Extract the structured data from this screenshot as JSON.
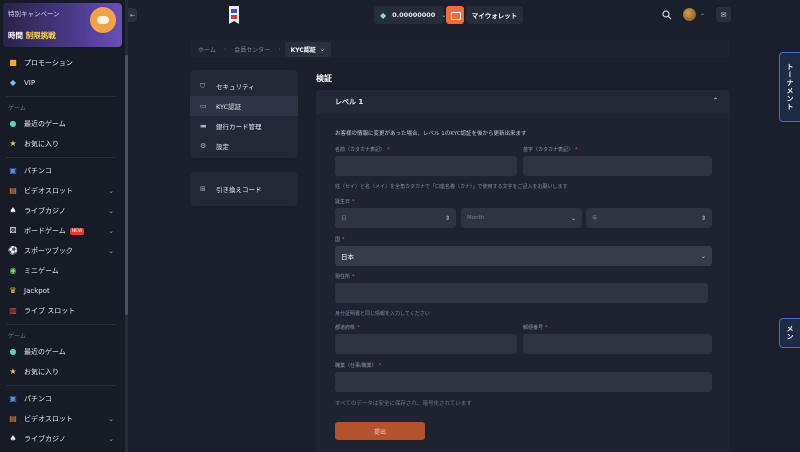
{
  "sidebar": {
    "promo": {
      "small_text": "特別キャンペーン",
      "big_prefix": "時間",
      "big_highlight": "制限挑戦"
    },
    "items_top": [
      {
        "label": "プロモーション",
        "icon": "gift-icon"
      },
      {
        "label": "VIP",
        "icon": "diamond-icon"
      }
    ],
    "section_game": "ゲーム",
    "items_game": [
      {
        "label": "最近のゲーム",
        "icon": "history-icon"
      },
      {
        "label": "お気に入り",
        "icon": "star-icon"
      }
    ],
    "items_cat": [
      {
        "label": "パチンコ",
        "icon": "pachinko-icon",
        "chevron": false
      },
      {
        "label": "ビデオスロット",
        "icon": "slot-icon",
        "chevron": true
      },
      {
        "label": "ライブカジノ",
        "icon": "cards-icon",
        "chevron": true
      },
      {
        "label": "ボードゲーム",
        "icon": "dice-icon",
        "chevron": true,
        "badge": "NEW"
      },
      {
        "label": "スポーツブック",
        "icon": "soccer-icon",
        "chevron": true
      },
      {
        "label": "ミニゲーム",
        "icon": "gamepad-icon",
        "chevron": false
      },
      {
        "label": "Jackpot",
        "icon": "crown-icon",
        "chevron": false
      },
      {
        "label": "ライブ スロット",
        "icon": "live-slot-icon",
        "chevron": false
      }
    ],
    "section_game2": "ゲーム",
    "items_game2": [
      {
        "label": "最近のゲーム",
        "icon": "history-icon"
      },
      {
        "label": "お気に入り",
        "icon": "star-icon"
      }
    ],
    "items_cat2": [
      {
        "label": "パチンコ",
        "icon": "pachinko-icon",
        "chevron": false
      },
      {
        "label": "ビデオスロット",
        "icon": "slot-icon",
        "chevron": true
      },
      {
        "label": "ライブカジノ",
        "icon": "cards-icon",
        "chevron": true
      }
    ]
  },
  "header": {
    "balance": "0.00000000",
    "wallet_label": "マイウォレット"
  },
  "breadcrumb": {
    "home": "ホーム",
    "center": "会員センター",
    "current": "KYC認証"
  },
  "menu": {
    "items": [
      {
        "label": "セキュリティ",
        "icon": "shield-icon"
      },
      {
        "label": "KYC認証",
        "icon": "id-card-icon"
      },
      {
        "label": "銀行カード管理",
        "icon": "bank-card-icon"
      },
      {
        "label": "設定",
        "icon": "settings-icon"
      }
    ],
    "redeem": {
      "label": "引き換えコード",
      "icon": "redeem-icon"
    }
  },
  "form": {
    "page_title": "検証",
    "level_title": "レベル 1",
    "notice": "お客様の情報に変更があった場合、レベル 1のKYC認証を後から更新出来ます",
    "last_name_label": "名前（カタカナ表記）",
    "first_name_label": "苗字（カタカナ表記）",
    "name_hint": "姓（セイ）と名（メイ）を全角カタカナで「口座名義（カナ）」で使用する文字をご記入をお願いします",
    "dob_label": "誕生日",
    "dob_day": "日",
    "dob_month": "Month",
    "dob_year": "年",
    "country_label": "国",
    "country_value": "日本",
    "address_label": "現住所",
    "id_hint": "身分証明書と同じ情報を入力してください",
    "city_label": "都道府県",
    "postal_label": "郵便番号",
    "occupation_label": "職業（仕事/職業）",
    "security_note": "すべてのデータは安全に保存され、暗号化されています",
    "submit_label": "提出"
  },
  "right_tabs": {
    "tournament": "トーナメント",
    "mission": "メン"
  },
  "colors": {
    "accent": "#f26b3a",
    "submit": "#b4522e",
    "tab_border": "#3d6bd1"
  }
}
